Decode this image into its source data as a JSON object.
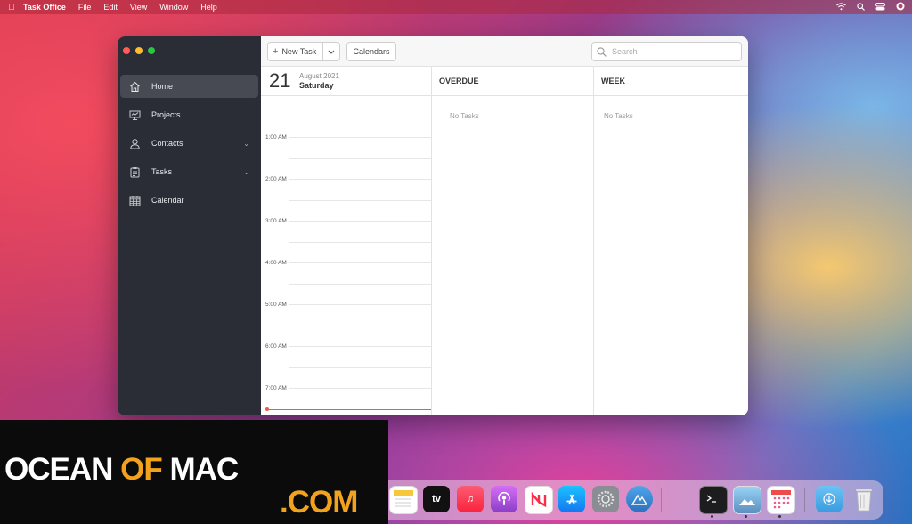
{
  "menubar": {
    "app_name": "Task Office",
    "menus": [
      "File",
      "Edit",
      "View",
      "Window",
      "Help"
    ]
  },
  "sidebar": {
    "items": [
      {
        "label": "Home",
        "icon": "home-icon",
        "active": true
      },
      {
        "label": "Projects",
        "icon": "projects-icon"
      },
      {
        "label": "Contacts",
        "icon": "contacts-icon",
        "expandable": true
      },
      {
        "label": "Tasks",
        "icon": "tasks-icon",
        "expandable": true
      },
      {
        "label": "Calendar",
        "icon": "calendar-icon"
      }
    ]
  },
  "toolbar": {
    "new_task_label": "New Task",
    "calendars_label": "Calendars",
    "search_placeholder": "Search"
  },
  "day": {
    "date_number": "21",
    "month_year": "August 2021",
    "weekday": "Saturday",
    "hours": [
      "1:00 AM",
      "2:00 AM",
      "3:00 AM",
      "4:00 AM",
      "5:00 AM",
      "6:00 AM",
      "7:00 AM"
    ]
  },
  "overdue": {
    "title": "OVERDUE",
    "empty_text": "No Tasks"
  },
  "week": {
    "title": "WEEK",
    "empty_text": "No Tasks"
  },
  "watermark": {
    "word1": "OCEAN",
    "word2": "OF",
    "word3": "MAC",
    "word4": ".COM"
  },
  "dock": {
    "apps": [
      "notes",
      "apple-tv",
      "music",
      "podcasts",
      "news",
      "app-store",
      "system-preferences",
      "altimeter",
      "terminal",
      "preview",
      "calendar-app",
      "downloads-folder",
      "trash"
    ],
    "tv_label": "tv"
  },
  "colors": {
    "sidebar_bg": "#2a2d36",
    "sidebar_active": "#474a53",
    "now_line": "#e65d4d",
    "watermark_accent": "#f2a21c"
  }
}
